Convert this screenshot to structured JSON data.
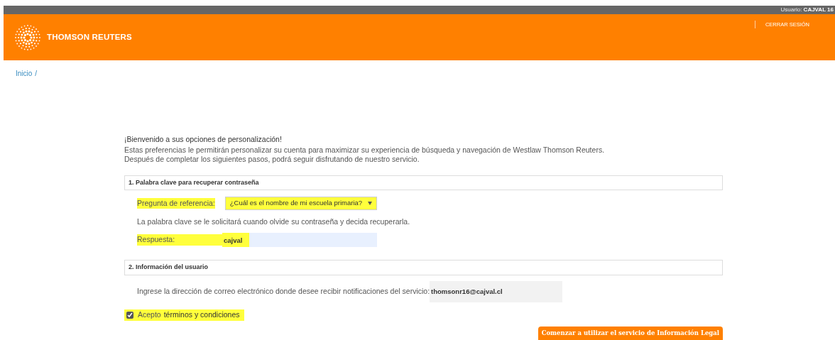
{
  "top_bar": {
    "user_label": "Usuario:",
    "user_name": "CAJVAL 16"
  },
  "header": {
    "brand": "THOMSON REUTERS",
    "logout": "CERRAR SESIÓN"
  },
  "breadcrumb": [
    "Inicio",
    "/"
  ],
  "intro": {
    "title": "¡Bienvenido a sus opciones de personalización!",
    "lines": [
      "Estas preferencias le permitirán personalizar su cuenta para maximizar su experiencia de búsqueda y navegación de Westlaw Thomson Reuters.",
      "Después de completar los siguientes pasos, podrá seguir disfrutando de nuestro servicio."
    ]
  },
  "section_1": {
    "title": "1. Palabra clave para recuperar contraseña",
    "question": {
      "label": "Pregunta de referencia:",
      "value": "¿Cuál es el nombre de mi escuela primaria?",
      "highlighted": true
    },
    "hint": "La palabra clave se le solicitará cuando olvide su contraseña y decida recuperarla.",
    "answer": {
      "label": "Respuesta:",
      "value": "cajval",
      "highlighted": true
    }
  },
  "section_2": {
    "title": "2. Información del usuario",
    "email_label": "Ingrese la dirección de correo electrónico donde desee recibir notificaciones del servicio:",
    "email_value": "thomsonr16@cajval.cl"
  },
  "terms": {
    "checked": true,
    "label": "Acepto",
    "link": "términos y condiciones",
    "highlighted": true
  },
  "submit": "Comenzar a utilizar el servicio de Información Legal"
}
